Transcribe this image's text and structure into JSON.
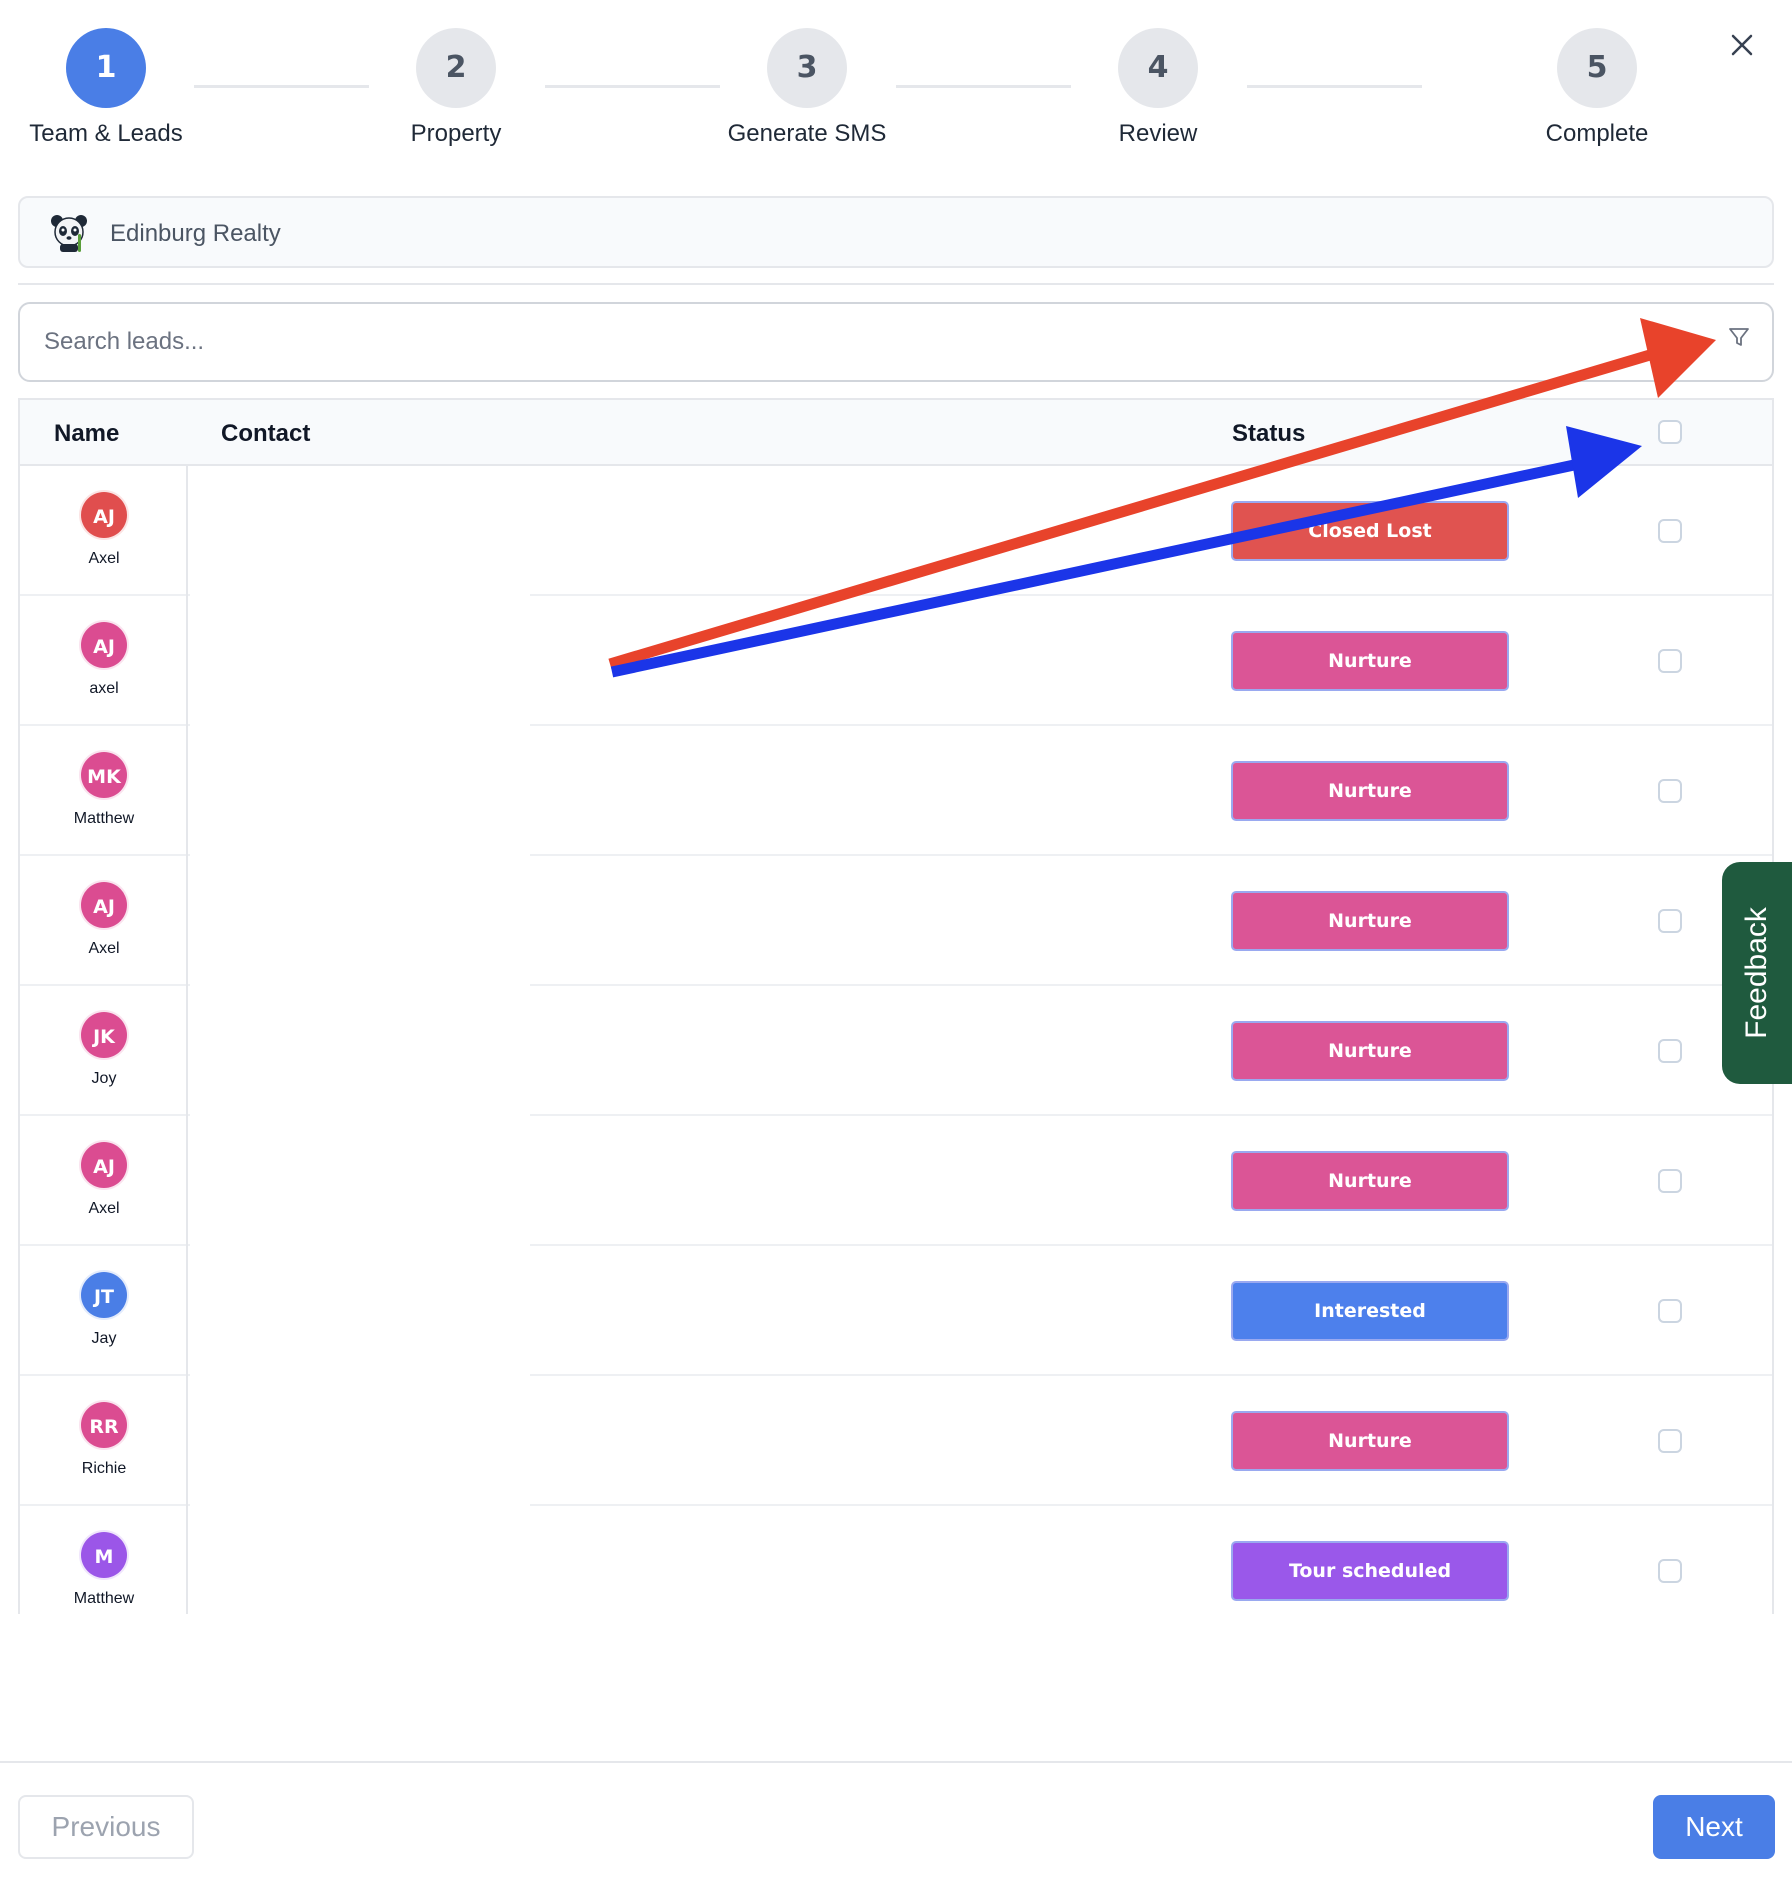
{
  "stepper": {
    "steps": [
      {
        "number": "1",
        "label": "Team & Leads",
        "active": true
      },
      {
        "number": "2",
        "label": "Property",
        "active": false
      },
      {
        "number": "3",
        "label": "Generate SMS",
        "active": false
      },
      {
        "number": "4",
        "label": "Review",
        "active": false
      },
      {
        "number": "5",
        "label": "Complete",
        "active": false
      }
    ]
  },
  "team": {
    "name": "Edinburg Realty",
    "logo_icon": "panda-logo-icon"
  },
  "search": {
    "placeholder": "Search leads..."
  },
  "table": {
    "columns": {
      "name": "Name",
      "contact": "Contact",
      "status": "Status"
    },
    "rows": [
      {
        "initials": "AJ",
        "first_name": "Axel",
        "avatar_color": "#e04e4e",
        "status": "Closed Lost",
        "status_color": "#e05350"
      },
      {
        "initials": "AJ",
        "first_name": "axel",
        "avatar_color": "#db4c91",
        "status": "Nurture",
        "status_color": "#db5596"
      },
      {
        "initials": "MK",
        "first_name": "Matthew",
        "avatar_color": "#db4c91",
        "status": "Nurture",
        "status_color": "#db5596"
      },
      {
        "initials": "AJ",
        "first_name": "Axel",
        "avatar_color": "#db4c91",
        "status": "Nurture",
        "status_color": "#db5596"
      },
      {
        "initials": "JK",
        "first_name": "Joy",
        "avatar_color": "#db4c91",
        "status": "Nurture",
        "status_color": "#db5596"
      },
      {
        "initials": "AJ",
        "first_name": "Axel",
        "avatar_color": "#db4c91",
        "status": "Nurture",
        "status_color": "#db5596"
      },
      {
        "initials": "JT",
        "first_name": "Jay",
        "avatar_color": "#4a7ee6",
        "status": "Interested",
        "status_color": "#4d80ec"
      },
      {
        "initials": "RR",
        "first_name": "Richie",
        "avatar_color": "#db4c91",
        "status": "Nurture",
        "status_color": "#db5596"
      },
      {
        "initials": "M",
        "first_name": "Matthew",
        "avatar_color": "#9b56e8",
        "status": "Tour scheduled",
        "status_color": "#9a58ea"
      }
    ]
  },
  "feedback": {
    "label": "Feedback",
    "color": "#1f5a3e"
  },
  "footer": {
    "previous_label": "Previous",
    "next_label": "Next",
    "accent": "#4a7ee6"
  },
  "annotations": {
    "arrow_1_color": "#e8432b",
    "arrow_2_color": "#1b35e8"
  }
}
